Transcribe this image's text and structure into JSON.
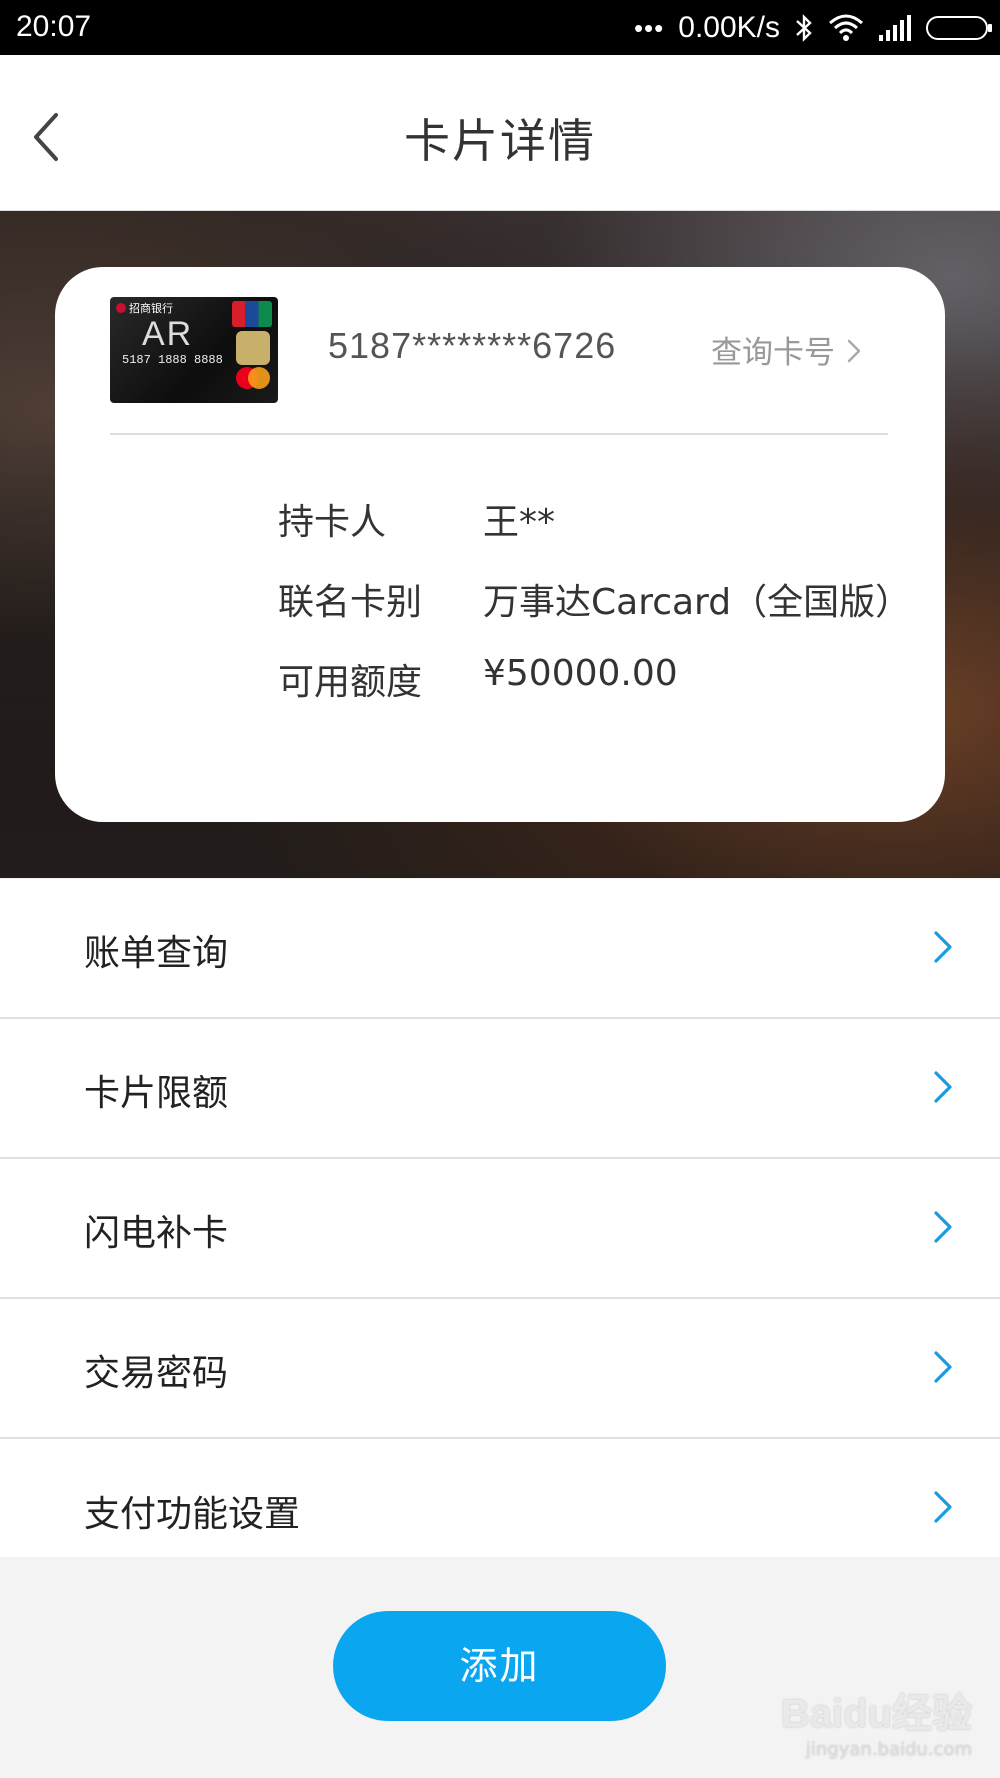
{
  "status_bar": {
    "time": "20:07",
    "dots": "•••",
    "net_speed": "0.00K/s"
  },
  "header": {
    "title": "卡片详情"
  },
  "card": {
    "thumbnail": {
      "bank_name": "招商银行",
      "brand": "AR",
      "number_preview": "5187 1888 8888"
    },
    "number": "5187********6726",
    "query_link": "查询卡号",
    "rows": [
      {
        "label": "持卡人",
        "value": "王**"
      },
      {
        "label": "联名卡别",
        "value": "万事达Carcard（全国版）"
      },
      {
        "label": "可用额度",
        "value": "¥50000.00"
      }
    ]
  },
  "menu": [
    {
      "label": "账单查询"
    },
    {
      "label": "卡片限额"
    },
    {
      "label": "闪电补卡"
    },
    {
      "label": "交易密码"
    },
    {
      "label": "支付功能设置"
    }
  ],
  "add_button": "添加",
  "watermark": {
    "main": "Baidu经验",
    "sub": "jingyan.baidu.com"
  },
  "colors": {
    "accent": "#0aa7f0",
    "chevron": "#1a9be0"
  }
}
